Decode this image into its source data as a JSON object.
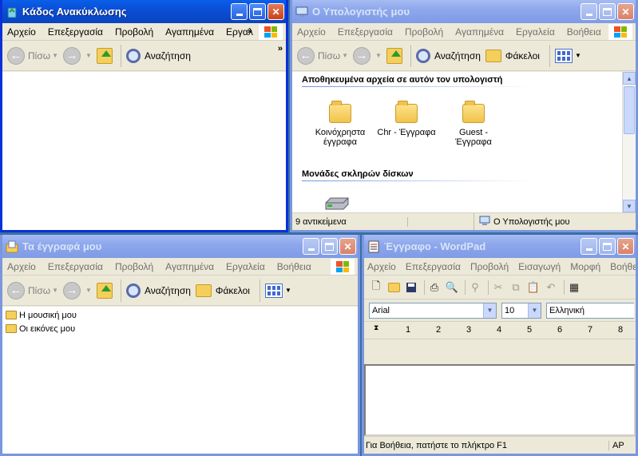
{
  "recycle": {
    "title": "Κάδος Ανακύκλωσης",
    "menu": [
      "Αρχείο",
      "Επεξεργασία",
      "Προβολή",
      "Αγαπημένα",
      "Εργαλ"
    ],
    "back": "Πίσω",
    "search": "Αναζήτηση"
  },
  "mycomputer": {
    "title": "Ο Υπολογιστής μου",
    "menu": [
      "Αρχείο",
      "Επεξεργασία",
      "Προβολή",
      "Αγαπημένα",
      "Εργαλεία",
      "Βοήθεια"
    ],
    "back": "Πίσω",
    "search": "Αναζήτηση",
    "folders": "Φάκελοι",
    "section1": "Αποθηκευμένα αρχεία σε αυτόν τον υπολογιστή",
    "items": [
      {
        "line1": "Κοινόχρηστα",
        "line2": "έγγραφα"
      },
      {
        "line1": "Chr - Έγγραφα",
        "line2": ""
      },
      {
        "line1": "Guest -",
        "line2": "Έγγραφα"
      }
    ],
    "section2": "Μονάδες σκληρών δίσκων",
    "status_count": "9 αντικείμενα",
    "status_location": "Ο Υπολογιστής μου"
  },
  "mydocs": {
    "title": "Τα έγγραφά μου",
    "menu": [
      "Αρχείο",
      "Επεξεργασία",
      "Προβολή",
      "Αγαπημένα",
      "Εργαλεία",
      "Βοήθεια"
    ],
    "back": "Πίσω",
    "search": "Αναζήτηση",
    "folders": "Φάκελοι",
    "items": [
      "Η μουσική μου",
      "Οι εικόνες μου"
    ]
  },
  "wordpad": {
    "title": "Έγγραφο - WordPad",
    "menu": [
      "Αρχείο",
      "Επεξεργασία",
      "Προβολή",
      "Εισαγωγή",
      "Μορφή",
      "Βοήθεια"
    ],
    "font": "Arial",
    "size": "10",
    "script": "Ελληνική",
    "ruler": [
      "1",
      "2",
      "3",
      "4",
      "5",
      "6",
      "7",
      "8"
    ],
    "status": "Για Βοήθεια, πατήστε το πλήκτρο F1",
    "status_mode": "ΑΡ"
  }
}
